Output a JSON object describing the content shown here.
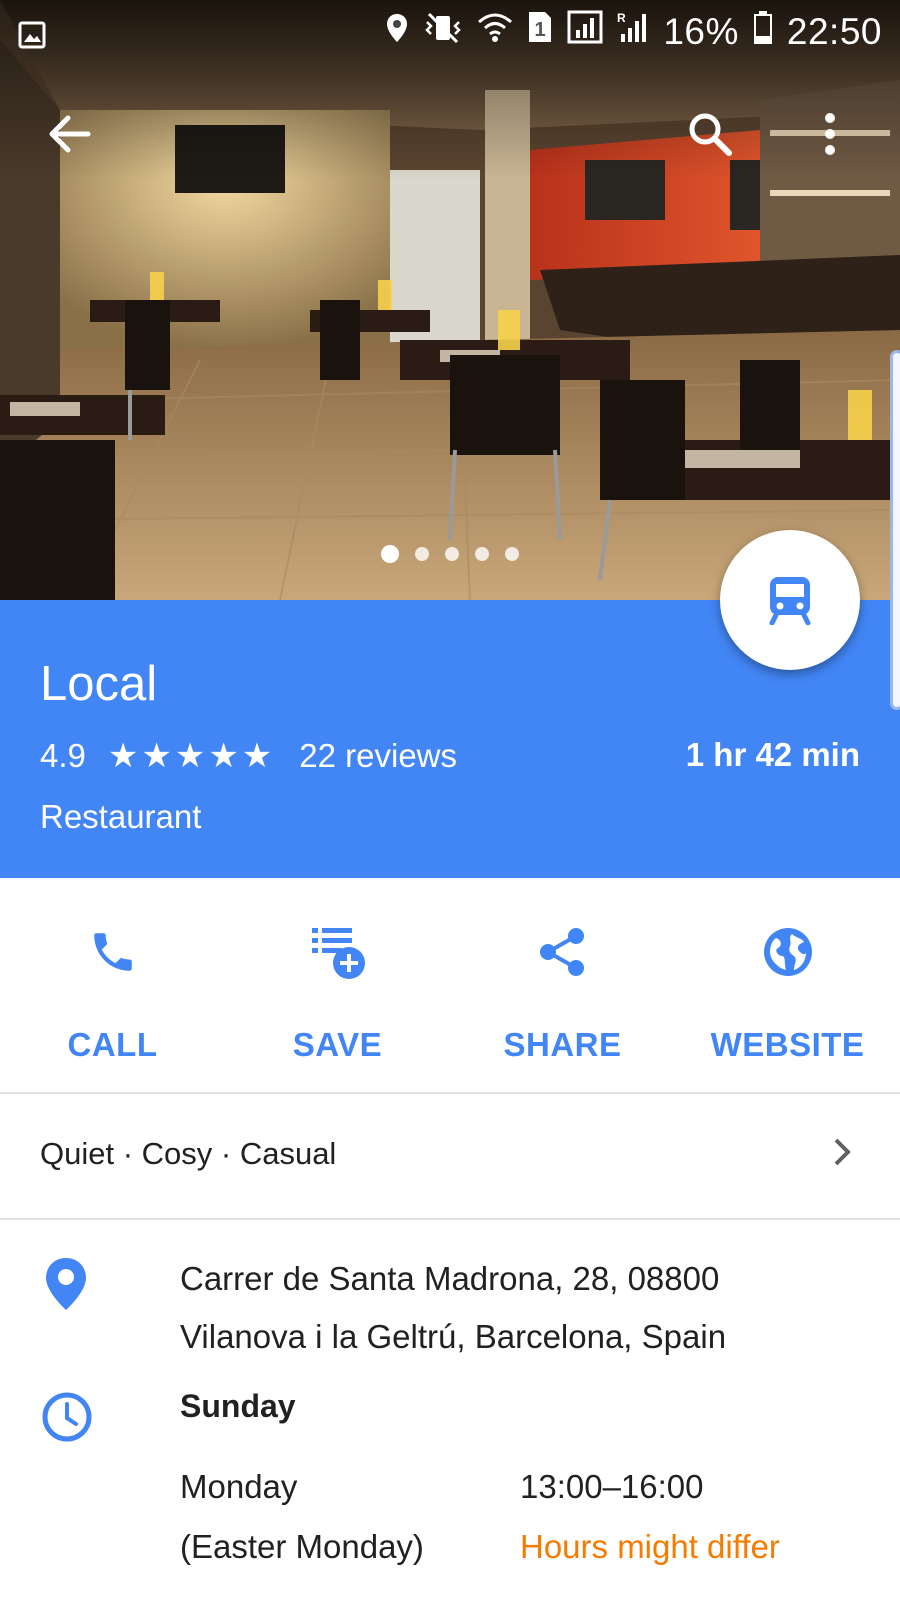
{
  "status_bar": {
    "battery": "16%",
    "time": "22:50",
    "icons": [
      "gallery-icon",
      "location-icon",
      "vibrate-off-icon",
      "wifi-icon",
      "sim-1-icon",
      "signal-icon",
      "roaming-signal-icon",
      "battery-icon"
    ]
  },
  "app_bar": {
    "icons": [
      "back-arrow-icon",
      "search-icon",
      "more-vert-icon"
    ]
  },
  "photos": {
    "count": 5,
    "active_index": 0
  },
  "place": {
    "name": "Local",
    "rating": "4.9",
    "stars": "★★★★★",
    "reviews": "22 reviews",
    "travel_time": "1 hr 42 min",
    "category": "Restaurant",
    "fab_icon": "transit-icon"
  },
  "actions": [
    {
      "label": "CALL",
      "icon": "phone-icon"
    },
    {
      "label": "SAVE",
      "icon": "playlist-add-icon"
    },
    {
      "label": "SHARE",
      "icon": "share-icon"
    },
    {
      "label": "WEBSITE",
      "icon": "globe-icon"
    }
  ],
  "tags": "Quiet · Cosy · Casual",
  "address": {
    "line1": "Carrer de Santa Madrona, 28, 08800",
    "line2": "Vilanova i la Geltrú, Barcelona, Spain"
  },
  "hours": {
    "today": "Sunday",
    "rows": [
      {
        "day": "Monday",
        "time": "13:00–16:00"
      },
      {
        "day": "(Easter Monday)",
        "time": "Hours might differ"
      }
    ]
  },
  "colors": {
    "accent": "#4285f4",
    "warning": "#f57c00",
    "text": "#212121"
  }
}
